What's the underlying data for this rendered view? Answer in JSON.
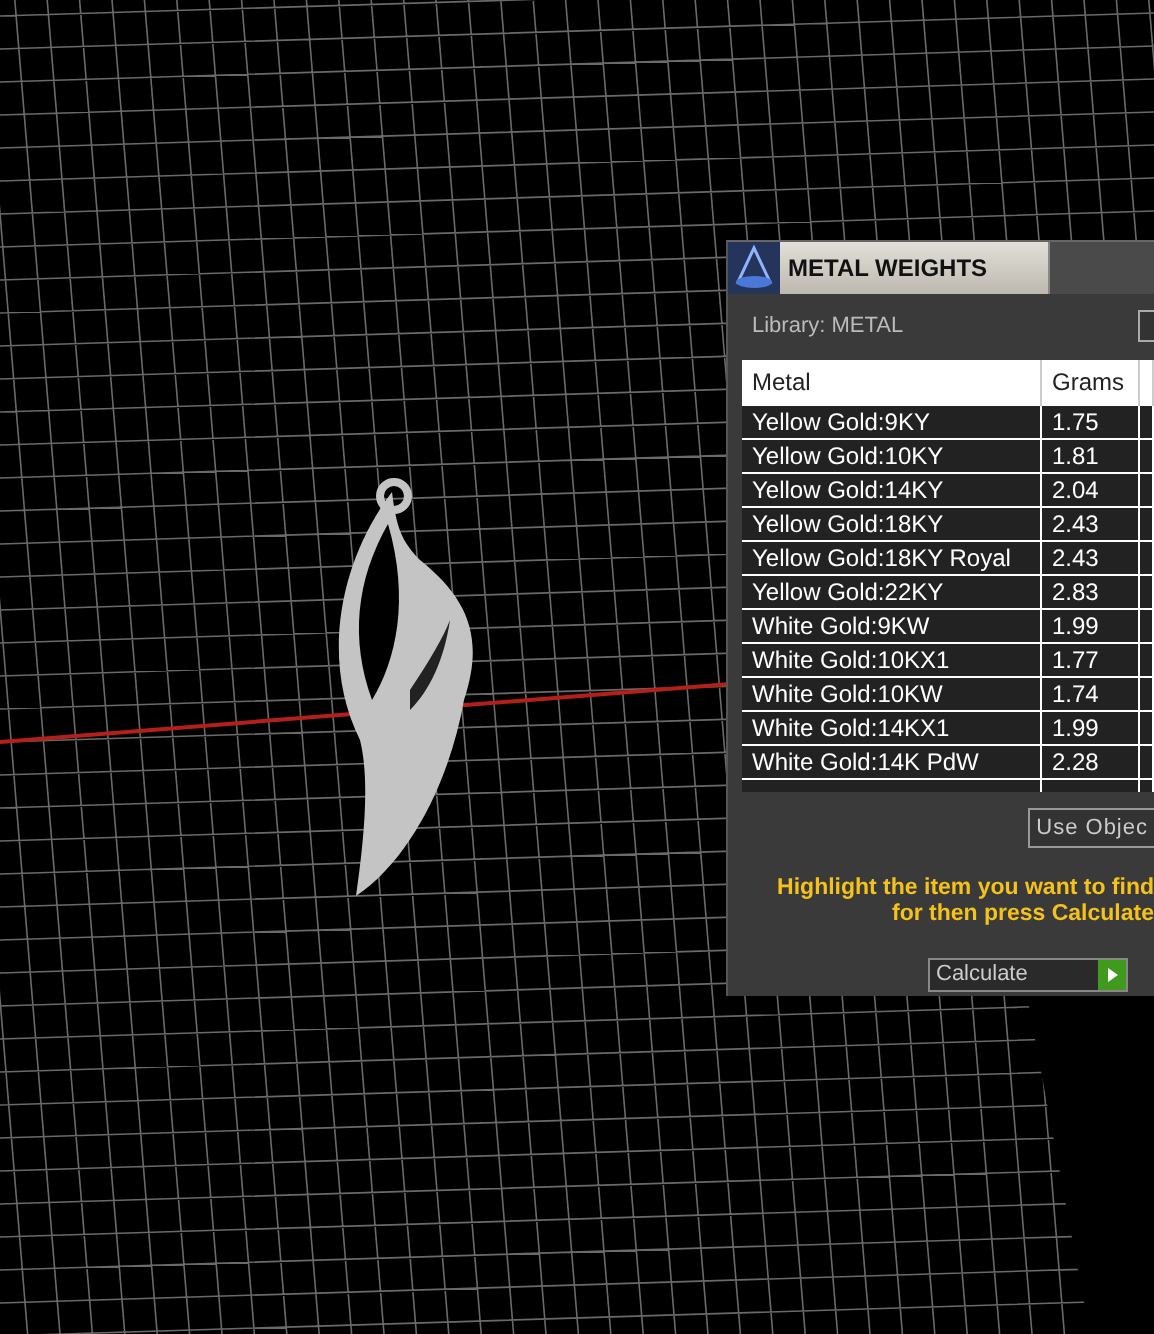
{
  "panel": {
    "title": "METAL WEIGHTS",
    "library_label": "Library: METAL",
    "table": {
      "columns": [
        "Metal",
        "Grams"
      ],
      "rows": [
        {
          "metal": "Yellow Gold:9KY",
          "grams": "1.75"
        },
        {
          "metal": "Yellow Gold:10KY",
          "grams": "1.81"
        },
        {
          "metal": "Yellow Gold:14KY",
          "grams": "2.04"
        },
        {
          "metal": "Yellow Gold:18KY",
          "grams": "2.43"
        },
        {
          "metal": "Yellow Gold:18KY Royal",
          "grams": "2.43"
        },
        {
          "metal": "Yellow Gold:22KY",
          "grams": "2.83"
        },
        {
          "metal": "White Gold:9KW",
          "grams": "1.99"
        },
        {
          "metal": "White Gold:10KX1",
          "grams": "1.77"
        },
        {
          "metal": "White Gold:10KW",
          "grams": "1.74"
        },
        {
          "metal": "White Gold:14KX1",
          "grams": "1.99"
        },
        {
          "metal": "White Gold:14K PdW",
          "grams": "2.28"
        }
      ]
    },
    "use_object_button": "Use Objec",
    "instructions": [
      "Highlight the item you want to find",
      "for then press Calculate"
    ],
    "action_dropdown": {
      "value": "Calculate"
    }
  }
}
